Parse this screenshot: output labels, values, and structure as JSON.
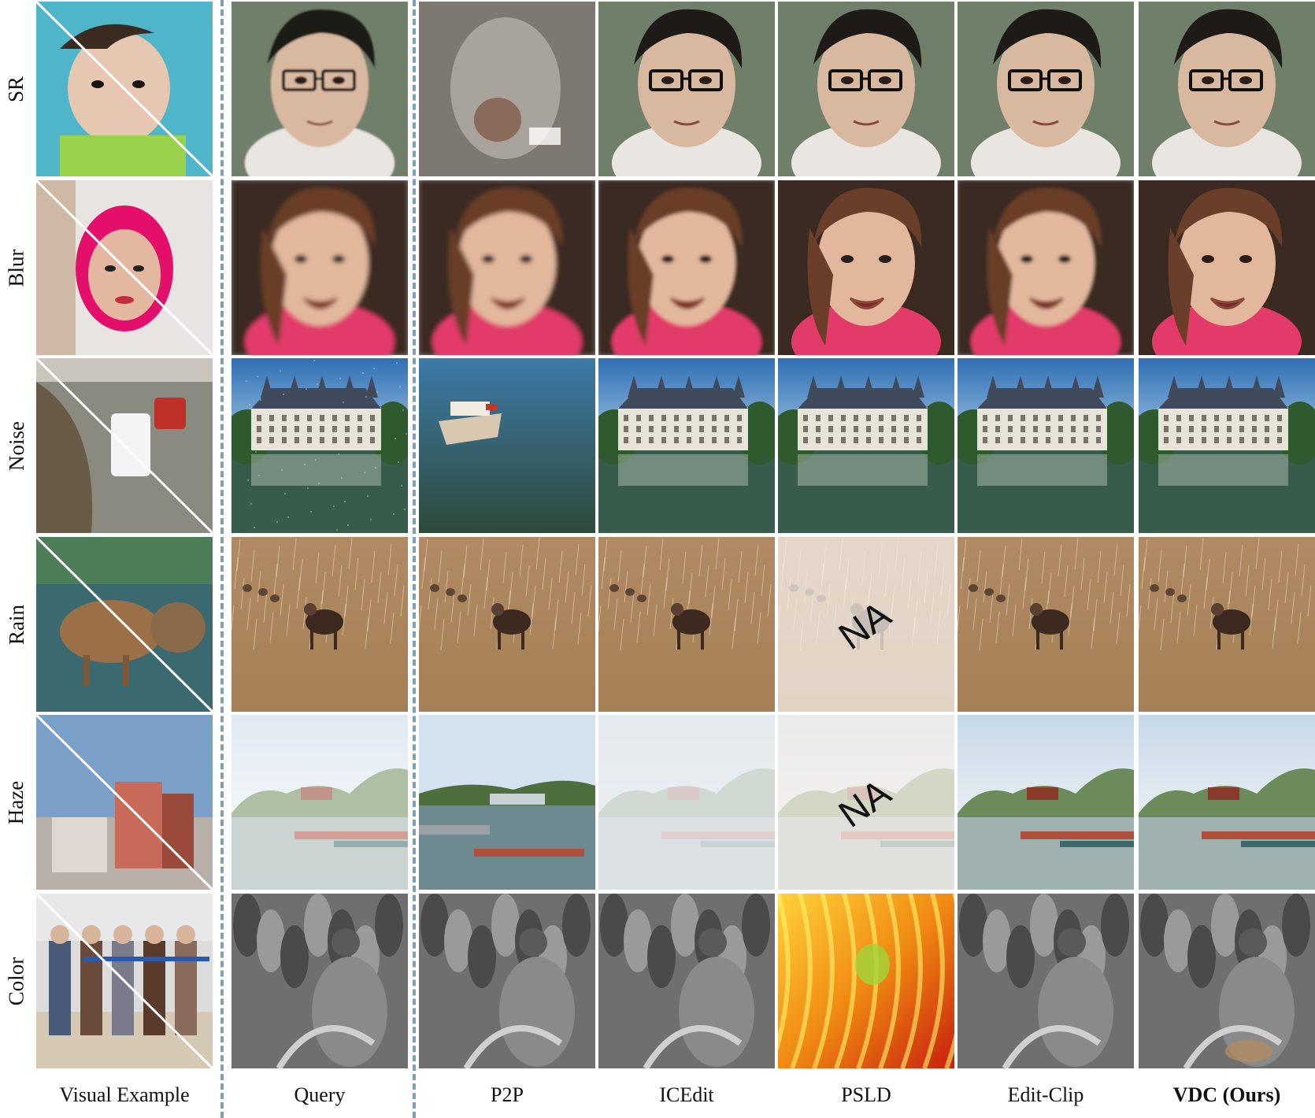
{
  "rows": [
    {
      "label": "SR"
    },
    {
      "label": "Blur"
    },
    {
      "label": "Noise"
    },
    {
      "label": "Rain"
    },
    {
      "label": "Haze"
    },
    {
      "label": "Color"
    }
  ],
  "columns": [
    {
      "label": "Visual Example",
      "bold": false
    },
    {
      "label": "Query",
      "bold": false
    },
    {
      "label": "P2P",
      "bold": false
    },
    {
      "label": "ICEdit",
      "bold": false
    },
    {
      "label": "PSLD",
      "bold": false
    },
    {
      "label": "Edit-Clip",
      "bold": false
    },
    {
      "label": "VDC (Ours)",
      "bold": true
    }
  ],
  "na_marks": [
    {
      "row": 3,
      "col": 4,
      "text": "NA"
    },
    {
      "row": 4,
      "col": 4,
      "text": "NA"
    }
  ],
  "colors": {
    "divider": "#7f9fb3",
    "background": "#ffffff"
  }
}
